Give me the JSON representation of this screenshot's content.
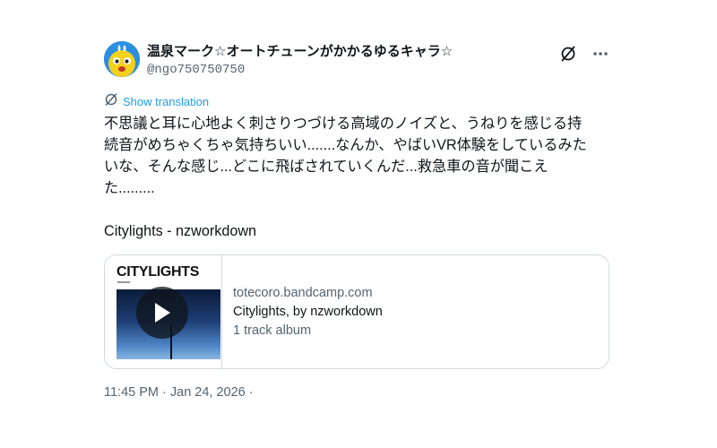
{
  "author": {
    "display_name": "温泉マーク☆オートチューンがかかるゆるキャラ☆",
    "handle": "@ngo750750750"
  },
  "header_icons": [
    "grok-icon",
    "more-icon"
  ],
  "translate": {
    "label": "Show translation"
  },
  "post": {
    "text": "不思議と耳に心地よく刺さりつづける高域のノイズと、うねりを感じる持\n続音がめちゃくちゃ気持ちいい.......なんか、やばいVR体験をしているみた\nいな、そんな感じ...どこに飛ばされていくんだ...救急車の音が聞こえ\nた.........\n\nCitylights - nzworkdown"
  },
  "card": {
    "album_title": "CITYLIGHTS",
    "domain": "totecoro.bandcamp.com",
    "title": "Citylights, by nzworkdown",
    "description": "1 track album"
  },
  "timestamp": "11:45 PM · Jan 24, 2026 ·",
  "colors": {
    "link": "#1d9bf0",
    "secondary_text": "#536471",
    "border": "#cfd9de"
  }
}
